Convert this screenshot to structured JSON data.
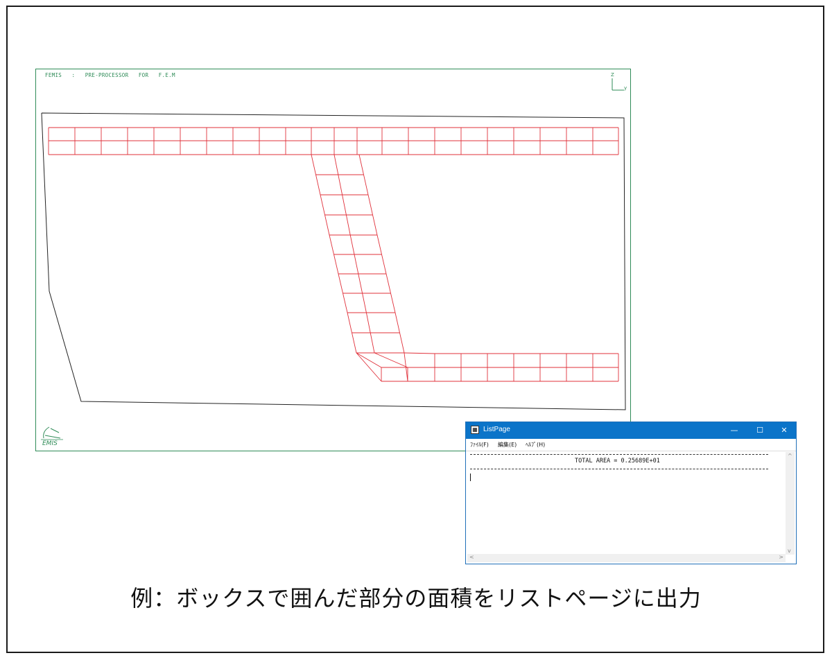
{
  "femis": {
    "title": "FEMIS   :   PRE-PROCESSOR   FOR   F.E.M",
    "axes": {
      "z": "Z",
      "y": "y"
    },
    "colors": {
      "frame": "#2e8b57",
      "mesh": "#e0303a",
      "outline": "#222222"
    },
    "logo_icon": "femis-logo"
  },
  "listpage": {
    "title": "ListPage",
    "controls": {
      "minimize": "—",
      "maximize": "☐",
      "close": "✕"
    },
    "menu": [
      "ﾌｧｲﾙ(F)",
      "編集(E)",
      "ﾍﾙﾌﾟ(H)"
    ],
    "total_area": "TOTAL AREA = 0.25689E+01",
    "colors": {
      "titlebar": "#0b74c9"
    }
  },
  "caption": "例：ボックスで囲んだ部分の面積をリストページに出力"
}
